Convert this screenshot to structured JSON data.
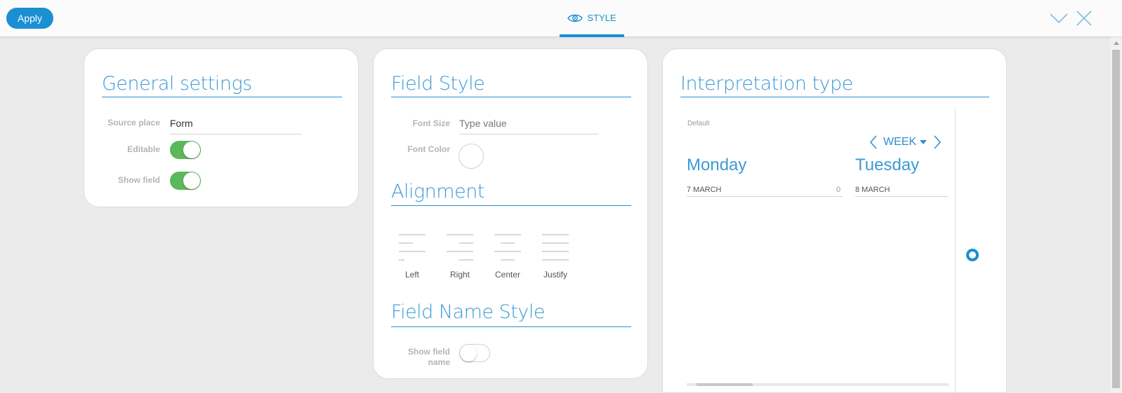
{
  "toolbar": {
    "apply_label": "Apply",
    "style_tab_label": "STYLE",
    "accent_color": "#1a8fd1"
  },
  "general": {
    "title": "General settings",
    "source_place_label": "Source place",
    "source_place_value": "Form",
    "editable_label": "Editable",
    "editable_on": true,
    "show_field_label": "Show field",
    "show_field_on": true
  },
  "field_style": {
    "title": "Field Style",
    "font_size_label": "Font Size",
    "font_size_placeholder": "Type value",
    "font_color_label": "Font Color",
    "alignment_title": "Alignment",
    "alignment_options": [
      "Left",
      "Right",
      "Center",
      "Justify"
    ],
    "field_name_style_title": "Field Name Style",
    "show_field_name_label_1": "Show field",
    "show_field_name_label_2": "name",
    "show_field_name_on": false
  },
  "interpretation": {
    "title": "Interpretation type",
    "default_label": "Default",
    "week_label": "WEEK",
    "days": [
      {
        "name": "Monday",
        "date": "7 MARCH",
        "count": "0"
      },
      {
        "name": "Tuesday",
        "date": "8 MARCH",
        "count": ""
      }
    ]
  }
}
